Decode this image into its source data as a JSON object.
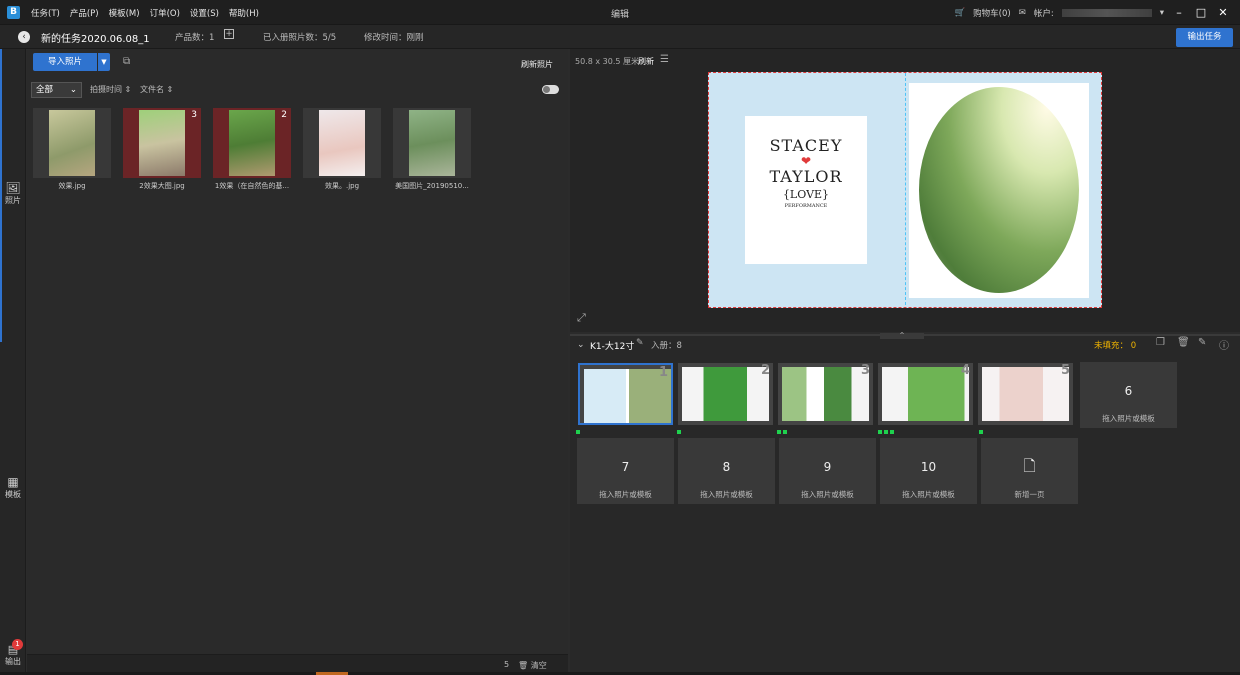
{
  "menubar": {
    "items": [
      "任务(T)",
      "产品(P)",
      "模板(M)",
      "订单(O)",
      "设置(S)",
      "帮助(H)"
    ],
    "window_title": "编辑",
    "cart": "购物车",
    "cart_count": "0",
    "account_label": "帐户:"
  },
  "taskbar": {
    "task_name": "新的任务2020.06.08_1",
    "product_count": "产品数：1",
    "added_photos": "已入册照片数：5/5",
    "modified": "修改时间：刚刚",
    "export": "输出任务"
  },
  "sidebar": {
    "photos": "照片",
    "templates": "模板",
    "output": "输出",
    "output_badge": "1"
  },
  "photo_panel": {
    "import": "导入照片",
    "refresh": "刷新照片",
    "filter": "全部",
    "sort_time": "拍摄时间",
    "sort_name": "文件名",
    "count": "5",
    "clear": "清空",
    "photos": [
      {
        "name": "效果.jpg",
        "badge": ""
      },
      {
        "name": "2效果大图.jpg",
        "badge": "3"
      },
      {
        "name": "1效果（在自然色的基...",
        "badge": "2"
      },
      {
        "name": "效果。.jpg",
        "badge": ""
      },
      {
        "name": "美国图片_20190510...",
        "badge": ""
      }
    ]
  },
  "preview": {
    "size": "50.8 x 30.5 厘米",
    "refresh": "刷新",
    "card": {
      "name1": "STACEY",
      "name2": "TAYLOR",
      "word": "{LOVE}",
      "sub": "PERFORMANCE"
    }
  },
  "pages": {
    "product": "K1-大12寸",
    "added": "入册：8",
    "unfilled_label": "未填充：",
    "unfilled": "0",
    "filled": [
      {
        "n": "1",
        "dots": 1
      },
      {
        "n": "2",
        "dots": 1
      },
      {
        "n": "3",
        "dots": 2
      },
      {
        "n": "4",
        "dots": 3
      },
      {
        "n": "5",
        "dots": 1
      }
    ],
    "empty": [
      {
        "n": "6",
        "t": "拖入照片或模板"
      },
      {
        "n": "7",
        "t": "拖入照片或模板"
      },
      {
        "n": "8",
        "t": "拖入照片或模板"
      },
      {
        "n": "9",
        "t": "拖入照片或模板"
      },
      {
        "n": "10",
        "t": "拖入照片或模板"
      }
    ],
    "add_page": "新增一页"
  },
  "colors": {
    "accent": "#2f73cf",
    "unfilled": "#f0b400",
    "dot": "#1fd14e",
    "heart": "#e03a3a"
  }
}
